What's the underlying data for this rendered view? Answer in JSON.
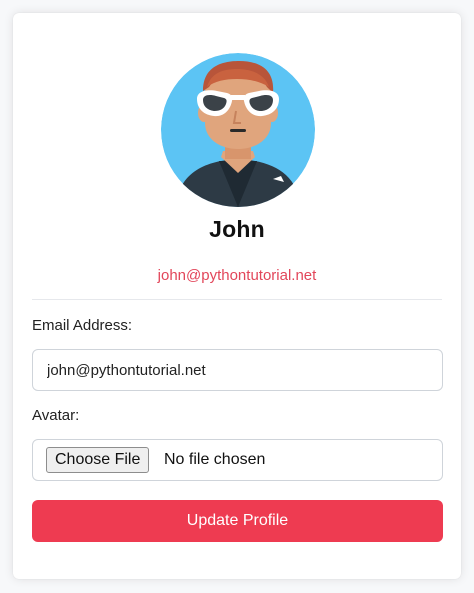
{
  "profile": {
    "avatar_icon": "avatar-person-sunglasses",
    "name": "John",
    "email": "john@pythontutorial.net"
  },
  "form": {
    "email_label": "Email Address:",
    "email_value": "john@pythontutorial.net",
    "avatar_label": "Avatar:",
    "file_button_label": "Choose File",
    "file_status": "No file chosen",
    "submit_label": "Update Profile"
  },
  "colors": {
    "accent": "#ee3b51",
    "email_text": "#e2465a",
    "avatar_background": "#5cc4f4"
  }
}
